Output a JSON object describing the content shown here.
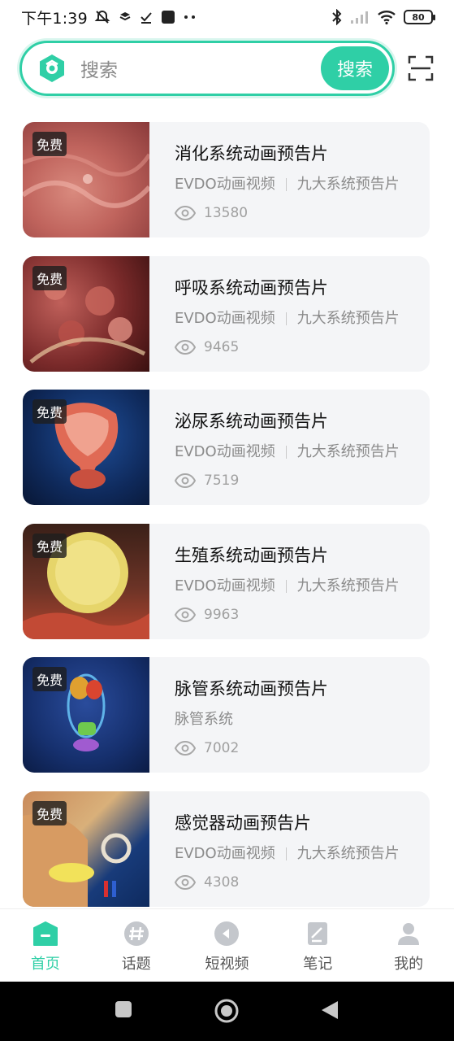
{
  "status_bar": {
    "time": "下午1:39",
    "battery": "80"
  },
  "search": {
    "placeholder": "搜索",
    "button_label": "搜索"
  },
  "colors": {
    "accent": "#2fcfa6",
    "card_bg": "#f4f5f7"
  },
  "videos": [
    {
      "badge": "免费",
      "title": "消化系统动画预告片",
      "source": "EVDO动画视频",
      "category": "九大系统预告片",
      "views": "13580"
    },
    {
      "badge": "免费",
      "title": "呼吸系统动画预告片",
      "source": "EVDO动画视频",
      "category": "九大系统预告片",
      "views": "9465"
    },
    {
      "badge": "免费",
      "title": "泌尿系统动画预告片",
      "source": "EVDO动画视频",
      "category": "九大系统预告片",
      "views": "7519"
    },
    {
      "badge": "免费",
      "title": "生殖系统动画预告片",
      "source": "EVDO动画视频",
      "category": "九大系统预告片",
      "views": "9963"
    },
    {
      "badge": "免费",
      "title": "脉管系统动画预告片",
      "source": "脉管系统",
      "category": "",
      "views": "7002"
    },
    {
      "badge": "免费",
      "title": "感觉器动画预告片",
      "source": "EVDO动画视频",
      "category": "九大系统预告片",
      "views": "4308"
    }
  ],
  "tabs": [
    {
      "label": "首页",
      "icon": "home-icon",
      "active": true
    },
    {
      "label": "话题",
      "icon": "hashtag-icon",
      "active": false
    },
    {
      "label": "短视频",
      "icon": "play-icon",
      "active": false
    },
    {
      "label": "笔记",
      "icon": "note-icon",
      "active": false
    },
    {
      "label": "我的",
      "icon": "profile-icon",
      "active": false
    }
  ]
}
